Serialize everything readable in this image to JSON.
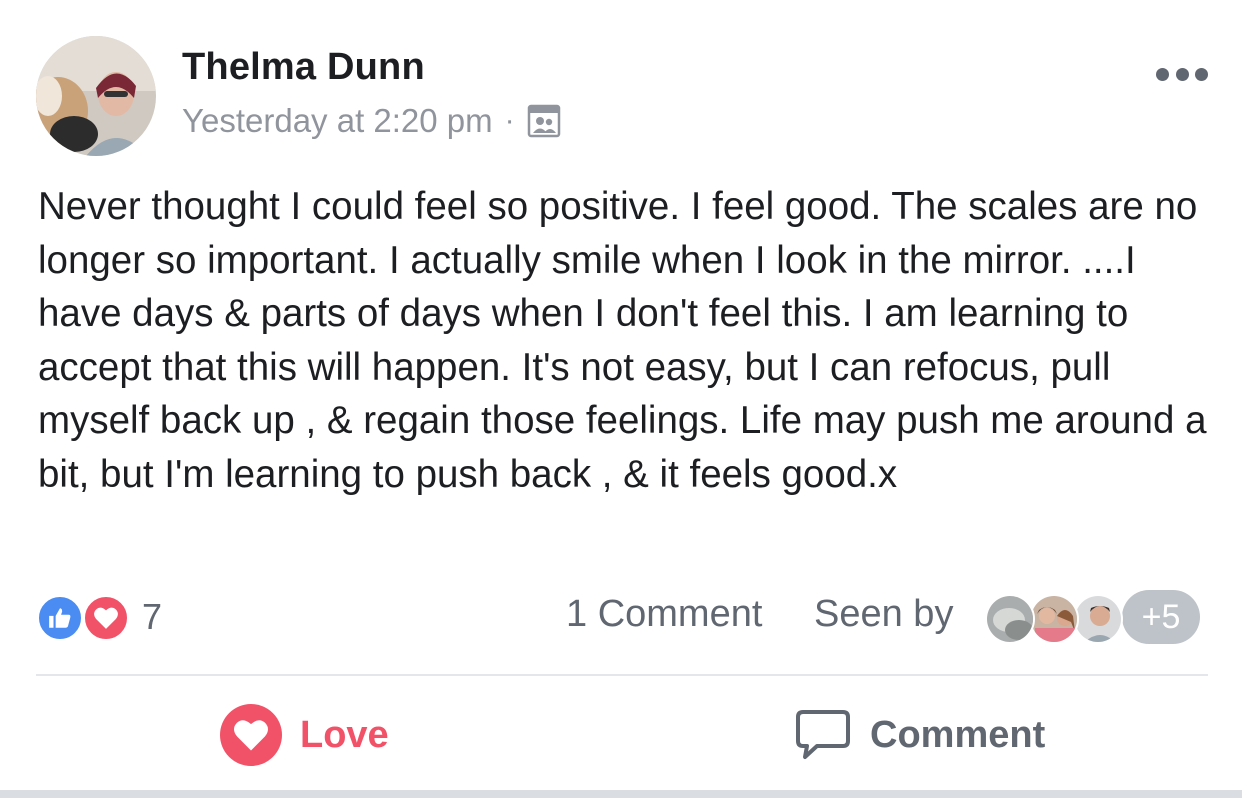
{
  "post": {
    "author": "Thelma Dunn",
    "timestamp": "Yesterday at 2:20 pm",
    "separator": "·",
    "audience_icon": "group-audience-icon",
    "body": "Never thought I could feel so positive. I feel good. The scales are no longer so important. I actually smile when I look in the mirror. ....I have days & parts of days when I don't feel this. I am learning to accept that this will happen. It's not easy, but I can refocus, pull myself back up , & regain those feelings. Life may push me around a bit, but I'm learning to push back , & it feels good.x"
  },
  "stats": {
    "reaction_count": "7",
    "comment_count": "1 Comment",
    "seen_by_label": "Seen by",
    "seen_more": "+5"
  },
  "actions": {
    "love_label": "Love",
    "comment_label": "Comment"
  },
  "colors": {
    "like_blue": "#4a8cf1",
    "love_red": "#f25268",
    "secondary_text": "#606770",
    "meta_text": "#90949c"
  }
}
